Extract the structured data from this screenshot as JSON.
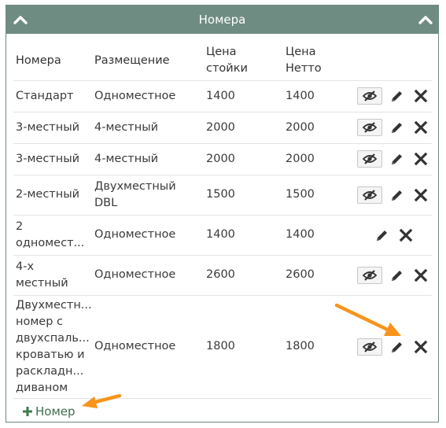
{
  "panel": {
    "title": "Номера",
    "header_color": "#6f8c82",
    "collapse_left_icon": "chevron-up-icon",
    "collapse_right_icon": "chevron-up-icon"
  },
  "table": {
    "columns": [
      "Номера",
      "Размещение",
      "Цена\nстойки",
      "Цена\nНетто"
    ],
    "rows": [
      {
        "name": "Стандарт",
        "placement": "Одноместное",
        "price_rack": "1400",
        "price_net": "1400",
        "has_visibility_toggle": true
      },
      {
        "name": "3-местный",
        "placement": "4-местный",
        "price_rack": "2000",
        "price_net": "2000",
        "has_visibility_toggle": true
      },
      {
        "name": "3-местный",
        "placement": "4-местный",
        "price_rack": "2000",
        "price_net": "2000",
        "has_visibility_toggle": true
      },
      {
        "name": "2-местный",
        "placement": "Двухместный\nDBL",
        "price_rack": "1500",
        "price_net": "1500",
        "has_visibility_toggle": true
      },
      {
        "name": "2\nодномест...",
        "placement": "Одноместное",
        "price_rack": "1400",
        "price_net": "1400",
        "has_visibility_toggle": false
      },
      {
        "name": "4-х\nместный",
        "placement": "Одноместное",
        "price_rack": "2600",
        "price_net": "2600",
        "has_visibility_toggle": true
      },
      {
        "name": "Двухместн...\nномер с\nдвухспаль...\nкроватью и\nраскладн...\nдиваном",
        "placement": "Одноместное",
        "price_rack": "1800",
        "price_net": "1800",
        "has_visibility_toggle": true
      }
    ],
    "row_actions": {
      "visibility_icon": "eye-off-icon",
      "edit_icon": "pencil-icon",
      "delete_icon": "close-icon"
    }
  },
  "add_button": {
    "label": "Номер",
    "icon": "plus-icon"
  },
  "annotations": {
    "arrow_color": "#f7941d",
    "arrows": [
      "arrow-to-edit-icon",
      "arrow-to-add-button"
    ]
  }
}
